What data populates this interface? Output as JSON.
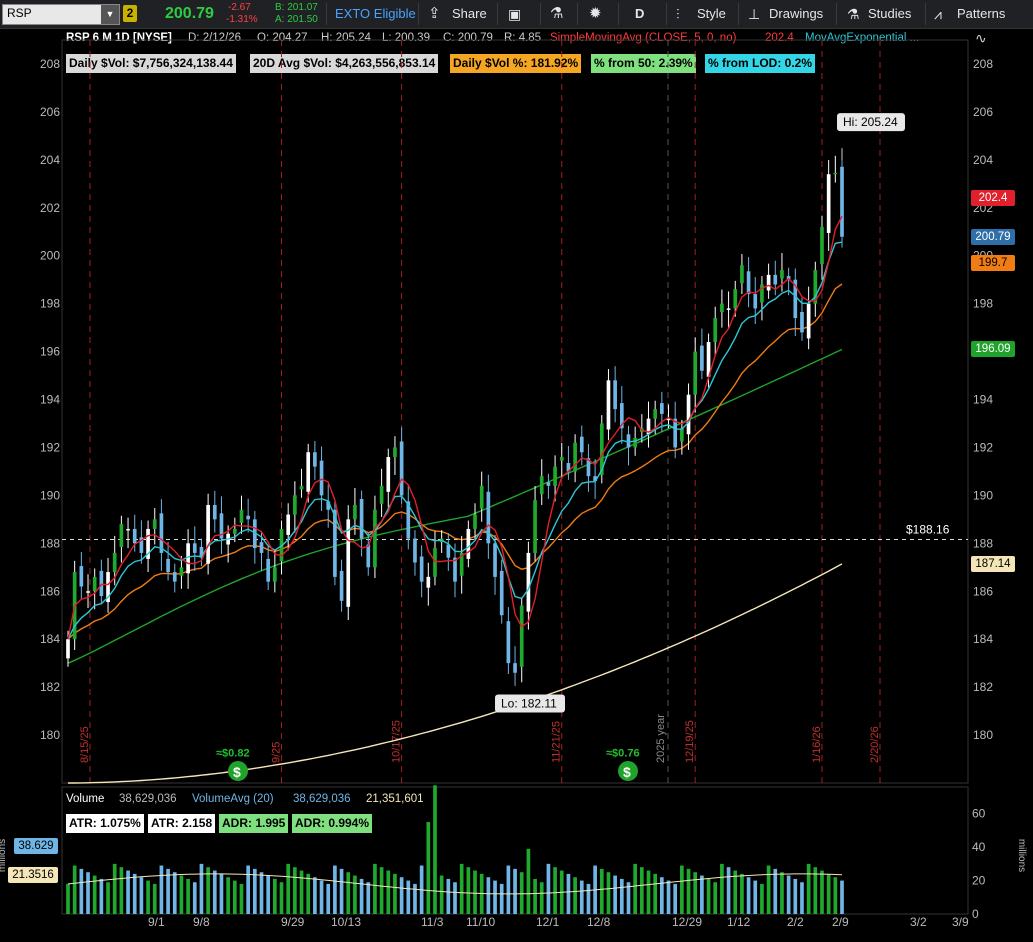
{
  "toolbar": {
    "symbol": "RSP",
    "link_badge": "2",
    "last_price": "200.79",
    "change": "-2.67",
    "change_pct": "-1.31%",
    "bid": "B: 201.07",
    "ask": "A: 201.50",
    "exto": "EXTO Eligible",
    "share": "Share",
    "period": "D",
    "style": "Style",
    "drawings": "Drawings",
    "studies": "Studies",
    "patterns": "Patterns"
  },
  "info_bar": {
    "title": "RSP 6 M 1D [NYSE]",
    "date": "D: 2/12/26",
    "open": "O: 204.27",
    "high": "H: 205.24",
    "low": "L: 200.39",
    "close": "C: 200.79",
    "range": "R: 4.85",
    "sma_label": "SimpleMovingAvg (CLOSE, 5, 0, no)",
    "sma_value": "202.4",
    "ema_label": "MovAvgExponential ..."
  },
  "stat_labels": [
    {
      "text": "Daily $Vol: $7,756,324,138.44",
      "color": "#d9d9d9"
    },
    {
      "text": "20D Avg $Vol: $4,263,556,853.14",
      "color": "#d9d9d9"
    },
    {
      "text": "Daily $Vol %: 181.92%",
      "color": "#f5a623"
    },
    {
      "text": "% from 50: 2.39%",
      "color": "#7fe07f"
    },
    {
      "text": "% from LOD: 0.2%",
      "color": "#33d6e6"
    }
  ],
  "annotations": {
    "hi_label": "Hi: 205.24",
    "lo_label": "Lo: 182.11",
    "hline_label": "$188.16",
    "dividend_1": "≈$0.82",
    "dividend_2": "≈$0.76",
    "year_marker": "2025 year"
  },
  "price_tags": [
    {
      "value": "202.4",
      "bg": "#e0202a",
      "fg": "#ffffff"
    },
    {
      "value": "200.79",
      "bg": "#2e6fa8",
      "fg": "#ffffff"
    },
    {
      "value": "199.7",
      "bg": "#f07c13",
      "fg": "#000000"
    },
    {
      "value": "196.09",
      "bg": "#1fa32b",
      "fg": "#ffffff"
    },
    {
      "value": "187.14",
      "bg": "#f5e6b8",
      "fg": "#000000"
    }
  ],
  "volume_panel": {
    "label": "Volume",
    "volume": "38,629,036",
    "vol_avg_label": "VolumeAvg (20)",
    "vol_avg": "38,629,036",
    "vol_other": "21,351,601",
    "atr_pct": "ATR: 1.075%",
    "atr": "ATR: 2.158",
    "adr": "ADR: 1.995",
    "adr_pct": "ADR: 0.994%",
    "tag_vol": "38.629",
    "tag_avg": "21.3516",
    "axis_unit": "millions"
  },
  "colors": {
    "up": "#1faa2e",
    "down": "#6fb6e6",
    "sma5": "#e0202a",
    "ema_fast": "#2fc6d6",
    "ema_mid": "#f07c13",
    "ema50": "#1fa32b",
    "sma200": "#f5e6b8"
  },
  "chart_data": {
    "type": "candlestick",
    "title": "RSP 6 M 1D [NYSE]",
    "ylim": [
      178,
      209
    ],
    "y_ticks": [
      180,
      182,
      184,
      186,
      188,
      190,
      192,
      194,
      196,
      198,
      200,
      202,
      204,
      206,
      208
    ],
    "x_tick_labels": [
      "9/1",
      "9/8",
      "9/29",
      "10/13",
      "11/3",
      "11/10",
      "12/1",
      "12/8",
      "12/29",
      "1/12",
      "2/2",
      "2/9",
      "3/2",
      "3/9"
    ],
    "event_dates": [
      "8/15/25",
      "9/25",
      "10/17/25",
      "11/21/25",
      "12/19/25",
      "1/16/26",
      "2/20/26"
    ],
    "closes": [
      184.0,
      186.8,
      186.2,
      186.0,
      186.6,
      185.8,
      186.8,
      187.6,
      188.8,
      188.6,
      188.0,
      187.6,
      188.6,
      189.0,
      187.6,
      186.8,
      186.4,
      187.0,
      188.0,
      187.6,
      187.4,
      189.6,
      189.0,
      188.2,
      188.4,
      188.6,
      189.4,
      189.0,
      187.8,
      187.6,
      186.4,
      187.0,
      188.6,
      189.2,
      190.0,
      190.4,
      191.8,
      191.2,
      190.0,
      189.4,
      186.6,
      185.6,
      189.0,
      189.6,
      188.2,
      187.0,
      189.4,
      190.4,
      191.6,
      192.0,
      190.0,
      188.2,
      187.2,
      186.4,
      186.6,
      187.8,
      188.2,
      187.4,
      186.4,
      187.6,
      188.6,
      189.2,
      190.4,
      188.0,
      186.6,
      185.0,
      183.0,
      182.6,
      185.4,
      187.6,
      189.8,
      190.8,
      190.4,
      191.2,
      191.6,
      191.0,
      192.2,
      191.8,
      190.8,
      190.6,
      193.0,
      194.8,
      193.6,
      192.8,
      192.0,
      192.4,
      192.8,
      193.2,
      193.6,
      193.4,
      193.2,
      192.0,
      192.8,
      194.2,
      196.0,
      195.2,
      196.4,
      197.4,
      198.0,
      197.8,
      198.6,
      199.6,
      198.4,
      197.8,
      198.8,
      199.2,
      198.8,
      199.4,
      199.0,
      197.4,
      196.8,
      198.0,
      199.4,
      201.2,
      203.4,
      203.46,
      200.79
    ],
    "hi": 205.24,
    "lo": 182.11,
    "horizontal_line": 188.16,
    "series": [
      {
        "name": "SimpleMovingAvg (CLOSE, 5, 0, no)",
        "last": 202.4
      },
      {
        "name": "MovAvgExponential",
        "last": 200.79
      },
      {
        "name": "EMA mid",
        "last": 199.7
      },
      {
        "name": "EMA 50",
        "last": 196.09
      },
      {
        "name": "SMA 200",
        "last": 187.14
      }
    ],
    "volume": {
      "ylim": [
        0,
        70
      ],
      "y_ticks": [
        0,
        20,
        40,
        60
      ],
      "unit": "millions",
      "last": 38.629,
      "avg": 21.3516
    }
  }
}
